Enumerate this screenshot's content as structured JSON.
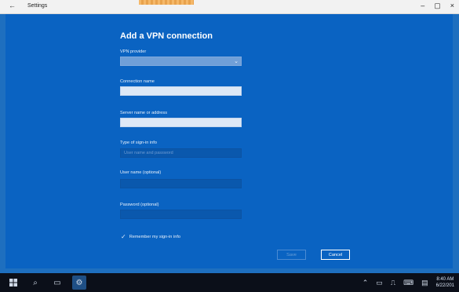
{
  "window": {
    "title": "Settings",
    "back_glyph": "←",
    "minimize_glyph": "–",
    "maximize_glyph": "▢",
    "close_glyph": "×"
  },
  "dialog": {
    "heading": "Add a VPN connection",
    "vpn_provider": {
      "label": "VPN provider",
      "selected_value": ""
    },
    "connection_name": {
      "label": "Connection name",
      "value": ""
    },
    "server": {
      "label": "Server name or address",
      "value": ""
    },
    "signin_type": {
      "label": "Type of sign-in info",
      "selected_value": "User name and password"
    },
    "username": {
      "label": "User name (optional)",
      "value": ""
    },
    "password": {
      "label": "Password (optional)",
      "value": ""
    },
    "remember": {
      "label": "Remember my sign-in info",
      "checked": true
    },
    "buttons": {
      "save": "Save",
      "cancel": "Cancel"
    }
  },
  "taskbar": {
    "start_icon": "windows-icon",
    "search_icon": "search-icon",
    "taskview_icon": "task-view-icon",
    "settings_icon": "gear-icon",
    "time": "8:40 AM",
    "date": "6/22/201"
  },
  "colors": {
    "accent": "#0a63c2",
    "titlebar": "#f2f2f2",
    "taskbar": "#0b0f19"
  }
}
